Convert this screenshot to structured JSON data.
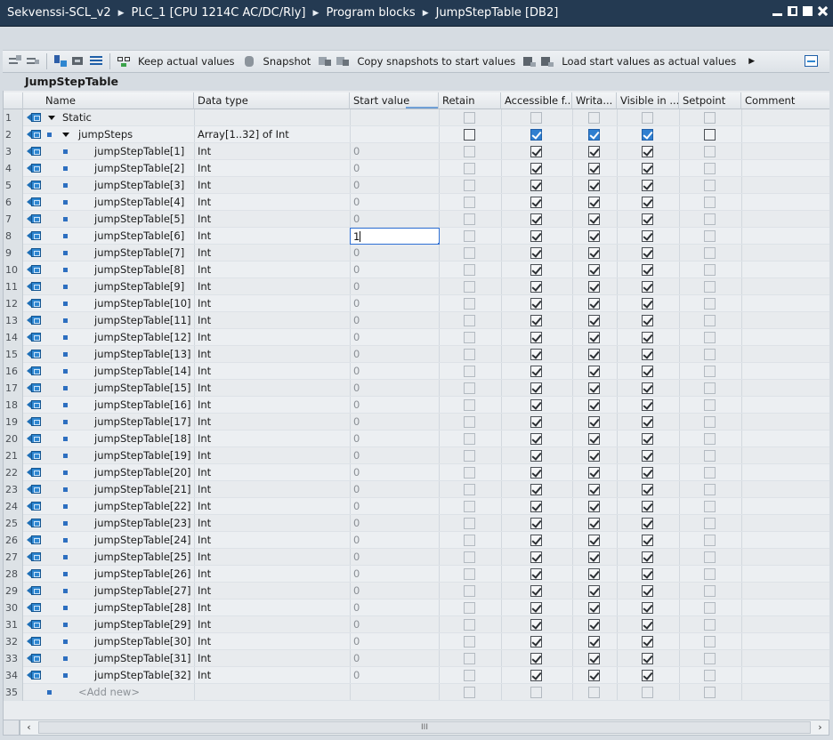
{
  "breadcrumb": [
    "Sekvenssi-SCL_v2",
    "PLC_1 [CPU 1214C AC/DC/Rly]",
    "Program blocks",
    "JumpStepTable [DB2]"
  ],
  "toolbar": {
    "keep_actual": "Keep actual values",
    "snapshot": "Snapshot",
    "copy_snapshots": "Copy snapshots to start values",
    "load_start": "Load start values as actual values"
  },
  "block_name": "JumpStepTable",
  "columns": [
    "Name",
    "Data type",
    "Start value",
    "Retain",
    "Accessible f...",
    "Writa...",
    "Visible in ...",
    "Setpoint",
    "Comment"
  ],
  "rows": [
    {
      "num": "1",
      "name": "Static",
      "type": "",
      "value": "",
      "kind": "section"
    },
    {
      "num": "2",
      "name": "jumpSteps",
      "type": "Array[1..32] of Int",
      "value": "",
      "kind": "array"
    },
    {
      "num": "3",
      "name": "jumpStepTable[1]",
      "type": "Int",
      "value": "0",
      "kind": "elem"
    },
    {
      "num": "4",
      "name": "jumpStepTable[2]",
      "type": "Int",
      "value": "0",
      "kind": "elem"
    },
    {
      "num": "5",
      "name": "jumpStepTable[3]",
      "type": "Int",
      "value": "0",
      "kind": "elem"
    },
    {
      "num": "6",
      "name": "jumpStepTable[4]",
      "type": "Int",
      "value": "0",
      "kind": "elem"
    },
    {
      "num": "7",
      "name": "jumpStepTable[5]",
      "type": "Int",
      "value": "0",
      "kind": "elem"
    },
    {
      "num": "8",
      "name": "jumpStepTable[6]",
      "type": "Int",
      "value": "1",
      "kind": "elem",
      "editing": true
    },
    {
      "num": "9",
      "name": "jumpStepTable[7]",
      "type": "Int",
      "value": "0",
      "kind": "elem"
    },
    {
      "num": "10",
      "name": "jumpStepTable[8]",
      "type": "Int",
      "value": "0",
      "kind": "elem"
    },
    {
      "num": "11",
      "name": "jumpStepTable[9]",
      "type": "Int",
      "value": "0",
      "kind": "elem"
    },
    {
      "num": "12",
      "name": "jumpStepTable[10]",
      "type": "Int",
      "value": "0",
      "kind": "elem"
    },
    {
      "num": "13",
      "name": "jumpStepTable[11]",
      "type": "Int",
      "value": "0",
      "kind": "elem"
    },
    {
      "num": "14",
      "name": "jumpStepTable[12]",
      "type": "Int",
      "value": "0",
      "kind": "elem"
    },
    {
      "num": "15",
      "name": "jumpStepTable[13]",
      "type": "Int",
      "value": "0",
      "kind": "elem"
    },
    {
      "num": "16",
      "name": "jumpStepTable[14]",
      "type": "Int",
      "value": "0",
      "kind": "elem"
    },
    {
      "num": "17",
      "name": "jumpStepTable[15]",
      "type": "Int",
      "value": "0",
      "kind": "elem"
    },
    {
      "num": "18",
      "name": "jumpStepTable[16]",
      "type": "Int",
      "value": "0",
      "kind": "elem"
    },
    {
      "num": "19",
      "name": "jumpStepTable[17]",
      "type": "Int",
      "value": "0",
      "kind": "elem"
    },
    {
      "num": "20",
      "name": "jumpStepTable[18]",
      "type": "Int",
      "value": "0",
      "kind": "elem"
    },
    {
      "num": "21",
      "name": "jumpStepTable[19]",
      "type": "Int",
      "value": "0",
      "kind": "elem"
    },
    {
      "num": "22",
      "name": "jumpStepTable[20]",
      "type": "Int",
      "value": "0",
      "kind": "elem"
    },
    {
      "num": "23",
      "name": "jumpStepTable[21]",
      "type": "Int",
      "value": "0",
      "kind": "elem"
    },
    {
      "num": "24",
      "name": "jumpStepTable[22]",
      "type": "Int",
      "value": "0",
      "kind": "elem"
    },
    {
      "num": "25",
      "name": "jumpStepTable[23]",
      "type": "Int",
      "value": "0",
      "kind": "elem"
    },
    {
      "num": "26",
      "name": "jumpStepTable[24]",
      "type": "Int",
      "value": "0",
      "kind": "elem"
    },
    {
      "num": "27",
      "name": "jumpStepTable[25]",
      "type": "Int",
      "value": "0",
      "kind": "elem"
    },
    {
      "num": "28",
      "name": "jumpStepTable[26]",
      "type": "Int",
      "value": "0",
      "kind": "elem"
    },
    {
      "num": "29",
      "name": "jumpStepTable[27]",
      "type": "Int",
      "value": "0",
      "kind": "elem"
    },
    {
      "num": "30",
      "name": "jumpStepTable[28]",
      "type": "Int",
      "value": "0",
      "kind": "elem"
    },
    {
      "num": "31",
      "name": "jumpStepTable[29]",
      "type": "Int",
      "value": "0",
      "kind": "elem"
    },
    {
      "num": "32",
      "name": "jumpStepTable[30]",
      "type": "Int",
      "value": "0",
      "kind": "elem"
    },
    {
      "num": "33",
      "name": "jumpStepTable[31]",
      "type": "Int",
      "value": "0",
      "kind": "elem"
    },
    {
      "num": "34",
      "name": "jumpStepTable[32]",
      "type": "Int",
      "value": "0",
      "kind": "elem"
    },
    {
      "num": "35",
      "name": "<Add new>",
      "type": "",
      "value": "",
      "kind": "add"
    }
  ],
  "scrollbar": {
    "thumb_grip": "III"
  },
  "colors": {
    "titlebar": "#243a52",
    "checked_blue": "#2f7fd0",
    "focus": "#2e6fd4"
  },
  "icons": {
    "row": "db-tag-icon",
    "element": "element-bullet-icon",
    "expand": "expand-triangle-icon"
  }
}
